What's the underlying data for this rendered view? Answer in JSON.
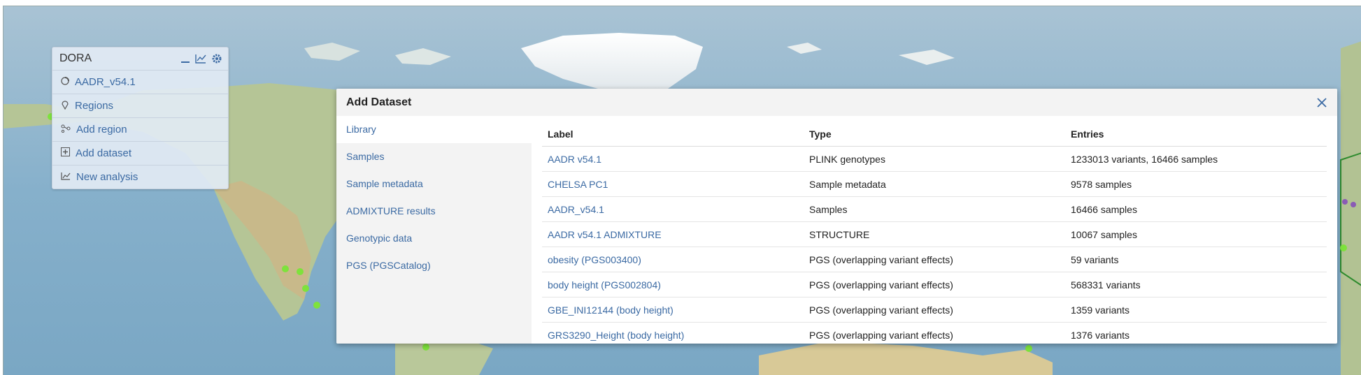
{
  "panel": {
    "title": "DORA",
    "items": [
      {
        "label": "AADR_v54.1",
        "icon": "dataset-icon"
      },
      {
        "label": "Regions",
        "icon": "map-pin-icon"
      },
      {
        "label": "Add region",
        "icon": "region-nodes-icon"
      },
      {
        "label": "Add dataset",
        "icon": "plus-square-icon"
      },
      {
        "label": "New analysis",
        "icon": "line-chart-icon"
      }
    ]
  },
  "dialog": {
    "title": "Add Dataset",
    "nav": [
      "Library",
      "Samples",
      "Sample metadata",
      "ADMIXTURE results",
      "Genotypic data",
      "PGS (PGSCatalog)"
    ],
    "active_nav": "Library",
    "table": {
      "headers": [
        "Label",
        "Type",
        "Entries"
      ],
      "rows": [
        [
          "AADR v54.1",
          "PLINK genotypes",
          "1233013 variants, 16466 samples"
        ],
        [
          "CHELSA PC1",
          "Sample metadata",
          "9578 samples"
        ],
        [
          "AADR_v54.1",
          "Samples",
          "16466 samples"
        ],
        [
          "AADR v54.1 ADMIXTURE",
          "STRUCTURE",
          "10067 samples"
        ],
        [
          "obesity (PGS003400)",
          "PGS (overlapping variant effects)",
          "59 variants"
        ],
        [
          "body height (PGS002804)",
          "PGS (overlapping variant effects)",
          "568331 variants"
        ],
        [
          "GBE_INI12144 (body height)",
          "PGS (overlapping variant effects)",
          "1359 variants"
        ],
        [
          "GRS3290_Height (body height)",
          "PGS (overlapping variant effects)",
          "1376 variants"
        ]
      ]
    }
  },
  "colors": {
    "ocean": "#8fb6cf",
    "land": "#b9c99a",
    "ice": "#f2f4f4",
    "link": "#3b6aa3",
    "marker": "#7ee23c",
    "region_outline": "#2e8b2e"
  }
}
